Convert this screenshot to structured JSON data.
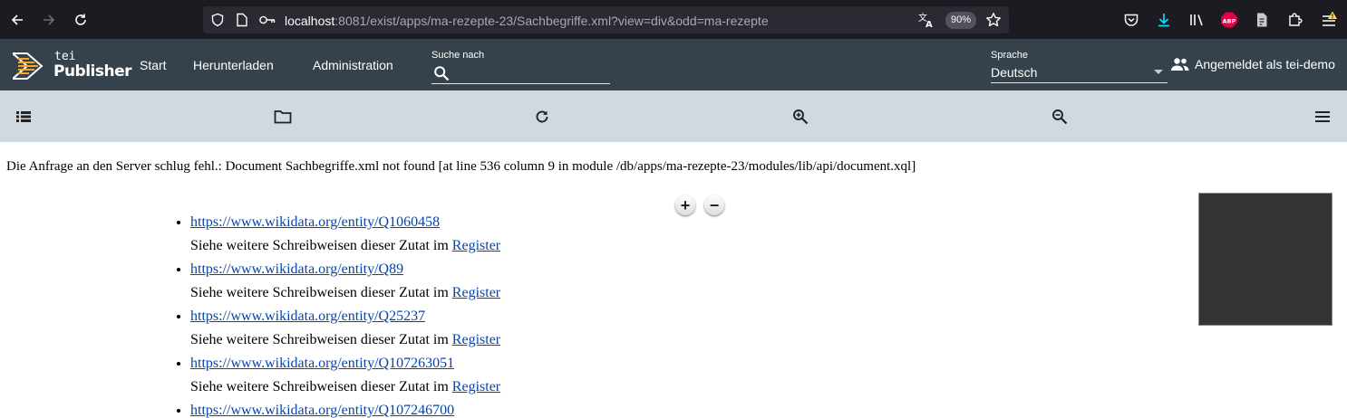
{
  "browser": {
    "url_host": "localhost",
    "url_rest": ":8081/exist/apps/ma-rezepte-23/Sachbegriffe.xml?view=div&odd=ma-rezepte",
    "zoom": "90%",
    "icons": [
      "back-icon",
      "forward-icon",
      "reload-icon",
      "shield-icon",
      "page-icon",
      "key-icon",
      "translate-icon",
      "star-icon",
      "pocket-icon",
      "download-icon",
      "library-icon",
      "adblock-icon",
      "reader-icon",
      "extensions-icon",
      "warning-icon",
      "menu-icon"
    ],
    "adblock_label": "ABP",
    "accent_color": "#00ddff",
    "warning_color": "#ffd567"
  },
  "header": {
    "logo_top": "tei",
    "logo_bottom": "Publisher",
    "menu": [
      "Start",
      "Herunterladen",
      "Administration"
    ],
    "search_label": "Suche nach",
    "language_label": "Sprache",
    "language_value": "Deutsch",
    "login_text": "Angemeldet als tei-demo",
    "background": "#35424b",
    "logo_stripe_color": "#f6a623"
  },
  "toolbar": {
    "icons": [
      "toc-icon",
      "folder-icon",
      "refresh-icon",
      "zoom-in-icon",
      "zoom-out-icon",
      "menu-icon"
    ],
    "background": "#d1d9e0"
  },
  "content": {
    "error_message": "Die Anfrage an den Server schlug fehl.: Document Sachbegriffe.xml not found [at line 536 column 9 in module /db/apps/ma-rezepte-23/modules/lib/api/document.xql]",
    "zoom_plus": "+",
    "zoom_minus": "−",
    "entries": [
      {
        "url": "https://www.wikidata.org/entity/Q1060458",
        "text": "Siehe weitere Schreibweisen dieser Zutat im ",
        "link": "Register"
      },
      {
        "url": "https://www.wikidata.org/entity/Q89",
        "text": "Siehe weitere Schreibweisen dieser Zutat im ",
        "link": "Register"
      },
      {
        "url": "https://www.wikidata.org/entity/Q25237",
        "text": "Siehe weitere Schreibweisen dieser Zutat im ",
        "link": "Register"
      },
      {
        "url": "https://www.wikidata.org/entity/Q107263051",
        "text": "Siehe weitere Schreibweisen dieser Zutat im ",
        "link": "Register"
      },
      {
        "url": "https://www.wikidata.org/entity/Q107246700",
        "text": "",
        "link": ""
      }
    ],
    "link_color": "#0645ad"
  }
}
